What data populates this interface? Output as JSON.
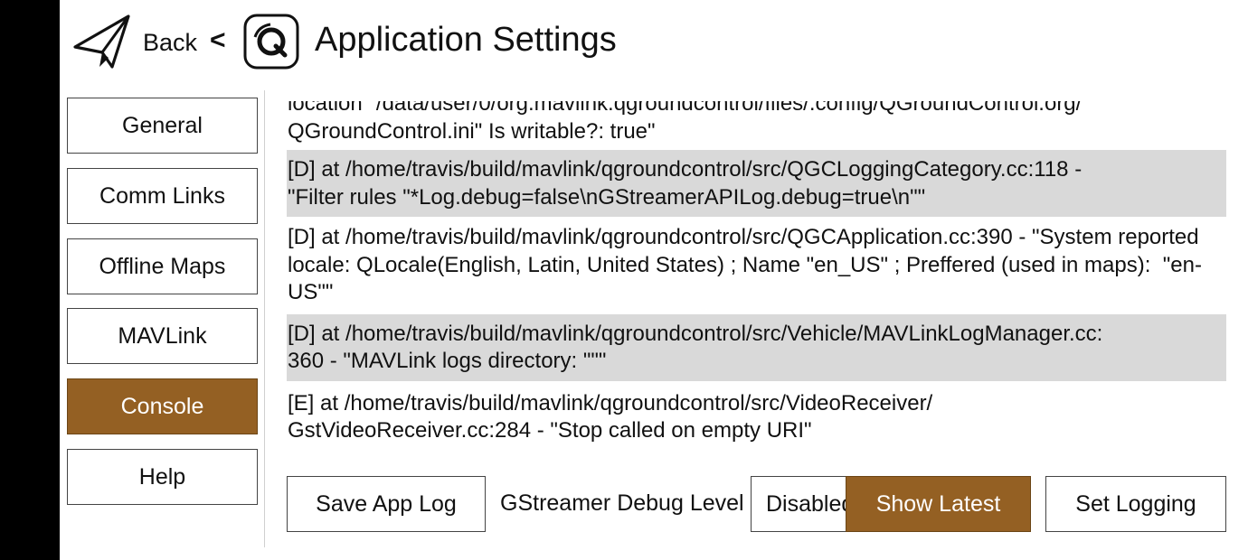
{
  "header": {
    "back_label": "Back",
    "separator": "<",
    "title": "Application Settings"
  },
  "nav": {
    "items": [
      {
        "label": "General",
        "active": false
      },
      {
        "label": "Comm Links",
        "active": false
      },
      {
        "label": "Offline Maps",
        "active": false
      },
      {
        "label": "MAVLink",
        "active": false
      },
      {
        "label": "Console",
        "active": true
      },
      {
        "label": "Help",
        "active": false
      }
    ]
  },
  "console": {
    "entries": [
      {
        "text": "location \"/data/user/0/org.mavlink.qgroundcontrol/files/.config/QGroundControl.org/\nQGroundControl.ini\" Is writable?: true\"",
        "shaded": false
      },
      {
        "text": "[D] at /home/travis/build/mavlink/qgroundcontrol/src/QGCLoggingCategory.cc:118 -\n\"Filter rules \"*Log.debug=false\\nGStreamerAPILog.debug=true\\n\"\"",
        "shaded": true
      },
      {
        "text": "[D] at /home/travis/build/mavlink/qgroundcontrol/src/QGCApplication.cc:390 - \"System reported locale: QLocale(English, Latin, United States) ; Name \"en_US\" ; Preffered (used in maps):  \"en-US\"\"",
        "shaded": false
      },
      {
        "text": "[D] at /home/travis/build/mavlink/qgroundcontrol/src/Vehicle/MAVLinkLogManager.cc:\n360 - \"MAVLink logs directory: \"\"\"",
        "shaded": true
      },
      {
        "text": "[E] at /home/travis/build/mavlink/qgroundcontrol/src/VideoReceiver/\nGstVideoReceiver.cc:284 - \"Stop called on empty URI\"",
        "shaded": false
      }
    ]
  },
  "footer": {
    "save_log_label": "Save App Log",
    "gst_debug_label": "GStreamer Debug Level",
    "gst_debug_value": "Disabled",
    "show_latest_label": "Show Latest",
    "set_logging_label": "Set Logging"
  },
  "colors": {
    "accent": "#946023",
    "shaded_row": "#d9d9d9",
    "left_bar": "#000000"
  }
}
